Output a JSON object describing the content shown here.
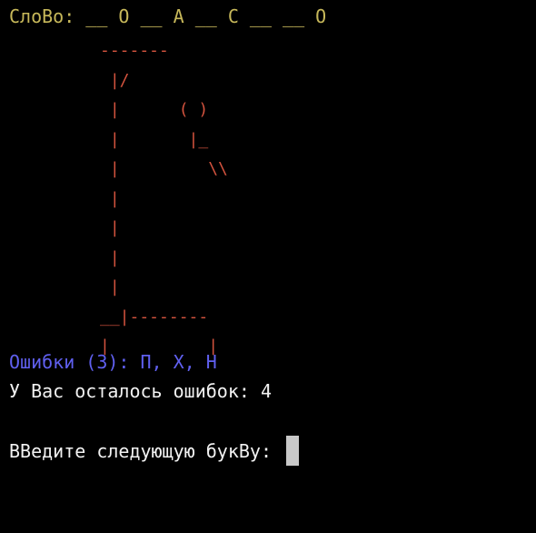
{
  "terminal": {
    "word_line": "СлоВо: __ О __ А __ С __ __ О",
    "gallows_art": "-------\n |/\n |      ( )\n |       |_\n |         \\\\\n |\n |\n |\n |\n__|--------\n|          |",
    "errors_line": "Ошибки (3): П, Х, Н",
    "remaining_line": "У Вас осталось ошибок: 4",
    "prompt_line": "ВВедите следующую букВу: "
  },
  "colors": {
    "background": "#000000",
    "word": "#c7b85a",
    "gallows": "#d4533e",
    "errors": "#6060f0",
    "text": "#f2f2f2",
    "cursor": "#c8c8c8"
  }
}
